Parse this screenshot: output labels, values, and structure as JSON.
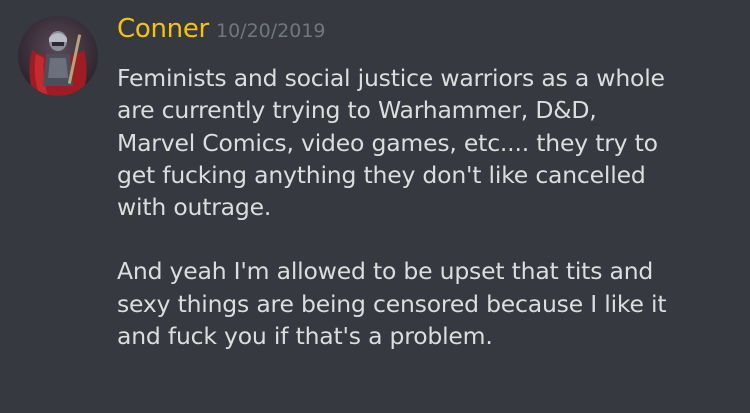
{
  "message": {
    "username": "Conner",
    "timestamp": "10/20/2019",
    "avatar_icon": "user-avatar",
    "username_color": "#f1c40f",
    "paragraphs": [
      "Feminists and social justice warriors as a whole\nare currently trying to  Warhammer, D&D,\nMarvel Comics, video games, etc.... they try to\nget fucking anything they don't like cancelled\nwith outrage.",
      "And yeah I'm allowed to be upset that tits and\nsexy things are being censored because I like it\nand fuck you if that's a problem."
    ]
  }
}
